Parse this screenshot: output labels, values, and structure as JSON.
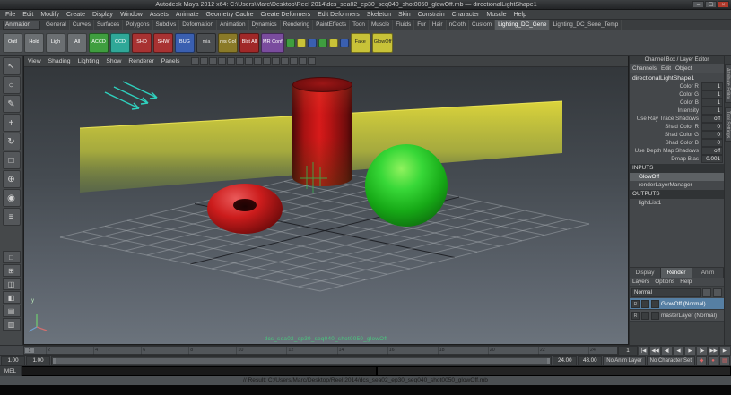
{
  "window": {
    "title": "Autodesk Maya 2012 x64: C:\\Users\\Marc\\Desktop\\Reel 2014\\dcs_sea02_ep30_seq040_shot0050_glowOff.mb  —  directionalLightShape1",
    "minimize": "–",
    "maximize": "☐",
    "close": "×"
  },
  "menubar": {
    "items": [
      "File",
      "Edit",
      "Modify",
      "Create",
      "Display",
      "Window",
      "Assets",
      "Animate",
      "Geometry Cache",
      "Create Deformers",
      "Edit Deformers",
      "Skeleton",
      "Skin",
      "Constrain",
      "Character",
      "Muscle",
      "Help"
    ]
  },
  "shelf_tabs": {
    "menu_set": "Animation",
    "tabs": [
      {
        "label": "General"
      },
      {
        "label": "Curves"
      },
      {
        "label": "Surfaces"
      },
      {
        "label": "Polygons"
      },
      {
        "label": "Subdivs"
      },
      {
        "label": "Deformation"
      },
      {
        "label": "Animation"
      },
      {
        "label": "Dynamics"
      },
      {
        "label": "Rendering"
      },
      {
        "label": "PaintEffects"
      },
      {
        "label": "Toon"
      },
      {
        "label": "Muscle"
      },
      {
        "label": "Fluids"
      },
      {
        "label": "Fur"
      },
      {
        "label": "Hair"
      },
      {
        "label": "nCloth"
      },
      {
        "label": "Custom"
      },
      {
        "label": "Lighting_DC_Gene",
        "active": true
      },
      {
        "label": "Lighting_DC_Sene_Temp"
      }
    ]
  },
  "shelf": {
    "items": [
      {
        "label": "Outl",
        "bg": "#6b6f72"
      },
      {
        "label": "Hold",
        "bg": "#6b6f72"
      },
      {
        "label": "Ligh",
        "bg": "#6b6f72"
      },
      {
        "label": "All",
        "bg": "#6b6f72"
      },
      {
        "label": "ACCD",
        "bg": "#3f9e3f"
      },
      {
        "label": "CCD",
        "bg": "#2fa898"
      },
      {
        "label": "SHD",
        "bg": "#a83232"
      },
      {
        "label": "SHW",
        "bg": "#a83232"
      },
      {
        "label": "BUG",
        "bg": "#3a5fb0"
      },
      {
        "label": "mia",
        "bg": "#4a4d50",
        "fg": "#dddddd"
      },
      {
        "label": "res Gol",
        "bg": "#8a7a28"
      },
      {
        "label": "Blst All",
        "bg": "#a02828"
      },
      {
        "label": "MR Conf",
        "bg": "#7a4c9e"
      },
      {
        "label": "",
        "bg": "#3f9e3f",
        "small": true
      },
      {
        "label": "",
        "bg": "#c8c238",
        "small": true
      },
      {
        "label": "",
        "bg": "#3a5fb0",
        "small": true
      },
      {
        "label": "",
        "bg": "#3f9e3f",
        "small": true
      },
      {
        "label": "",
        "bg": "#c8c238",
        "small": true
      },
      {
        "label": "",
        "bg": "#3a5fb0",
        "small": true
      },
      {
        "label": "Fake",
        "bg": "#c8c238",
        "fg": "#222222"
      },
      {
        "label": "GlowOff",
        "bg": "#c8c238",
        "fg": "#222222"
      }
    ]
  },
  "toolbox": {
    "tools": [
      {
        "name": "select-tool",
        "glyph": "↖"
      },
      {
        "name": "lasso-tool",
        "glyph": "○"
      },
      {
        "name": "paint-select-tool",
        "glyph": "✎"
      },
      {
        "name": "move-tool",
        "glyph": "+"
      },
      {
        "name": "rotate-tool",
        "glyph": "↻"
      },
      {
        "name": "scale-tool",
        "glyph": "□"
      },
      {
        "name": "universal-manipulator-tool",
        "glyph": "⊕"
      },
      {
        "name": "soft-mod-tool",
        "glyph": "◉"
      },
      {
        "name": "last-tool",
        "glyph": "≡"
      }
    ],
    "layouts": [
      {
        "name": "single-pane-layout-button",
        "glyph": "□"
      },
      {
        "name": "four-pane-layout-button",
        "glyph": "⊞"
      },
      {
        "name": "two-pane-layout-button",
        "glyph": "◫"
      },
      {
        "name": "persp-outliner-layout-button",
        "glyph": "◧"
      },
      {
        "name": "hypershade-layout-button",
        "glyph": "▤"
      },
      {
        "name": "graph-layout-button",
        "glyph": "▥"
      }
    ]
  },
  "panel_menu": {
    "items": [
      "View",
      "Shading",
      "Lighting",
      "Show",
      "Renderer",
      "Panels"
    ],
    "icons": [
      "select-camera-icon",
      "lock-camera-icon",
      "camera-attributes-icon",
      "bookmark-icon",
      "image-plane-icon",
      "two-d-pan-zoom-icon",
      "grid-icon",
      "film-gate-icon",
      "resolution-gate-icon",
      "gate-mask-icon",
      "field-chart-icon",
      "safe-action-icon",
      "safe-title-icon",
      "hud-icon"
    ]
  },
  "viewport": {
    "hud": "dcs_sea02_ep30_seq040_shot0050_glowOff",
    "axis_label": "y",
    "background_top": "#33373b",
    "background_bottom": "#6b737c"
  },
  "scene": {
    "objects": [
      {
        "name": "red-cylinder",
        "color": "#c81414"
      },
      {
        "name": "red-torus",
        "color": "#b01212"
      },
      {
        "name": "green-sphere",
        "color": "#28c828"
      },
      {
        "name": "yellow-light-plane",
        "color": "#e2da3c"
      },
      {
        "name": "directional-light-arrows",
        "color": "#2fd0bd"
      }
    ]
  },
  "channel_box": {
    "header": "Channel Box / Layer Editor",
    "menus": [
      "Channels",
      "Edit",
      "Object"
    ],
    "node": "directionalLightShape1",
    "channels": [
      {
        "name": "Color R",
        "value": "1"
      },
      {
        "name": "Color G",
        "value": "1"
      },
      {
        "name": "Color B",
        "value": "1"
      },
      {
        "name": "Intensity",
        "value": "1"
      },
      {
        "name": "Use Ray Trace Shadows",
        "value": "off"
      },
      {
        "name": "Shad Color R",
        "value": "0"
      },
      {
        "name": "Shad Color G",
        "value": "0"
      },
      {
        "name": "Shad Color B",
        "value": "0"
      },
      {
        "name": "Use Depth Map Shadows",
        "value": "off"
      },
      {
        "name": "Dmap Bias",
        "value": "0.001"
      }
    ],
    "inputs_label": "INPUTS",
    "inputs": [
      {
        "name": "GlowOff",
        "selected": true
      },
      {
        "name": "renderLayerManager"
      }
    ],
    "outputs_label": "OUTPUTS",
    "outputs": [
      {
        "name": "lightList1"
      }
    ]
  },
  "layer_editor": {
    "tabs": [
      {
        "label": "Display"
      },
      {
        "label": "Render",
        "active": true
      },
      {
        "label": "Anim"
      }
    ],
    "menus": [
      "Layers",
      "Options",
      "Help"
    ],
    "blend_mode": "Normal",
    "layers": [
      {
        "name": "GlowOff (Normal)",
        "selected": true
      },
      {
        "name": "masterLayer (Normal)"
      }
    ]
  },
  "sidebar_tabs": [
    "Attribute Editor",
    "Tool Settings"
  ],
  "time_slider": {
    "ticks": [
      "2",
      "4",
      "6",
      "8",
      "10",
      "12",
      "14",
      "16",
      "18",
      "20",
      "22",
      "24"
    ],
    "current_frame": "1"
  },
  "playback": {
    "buttons": [
      {
        "name": "go-to-start-button",
        "glyph": "|◀"
      },
      {
        "name": "step-back-key-button",
        "glyph": "◀◀"
      },
      {
        "name": "step-back-frame-button",
        "glyph": "◀|"
      },
      {
        "name": "play-backward-button",
        "glyph": "◀"
      },
      {
        "name": "play-forward-button",
        "glyph": "▶"
      },
      {
        "name": "step-forward-frame-button",
        "glyph": "|▶"
      },
      {
        "name": "step-forward-key-button",
        "glyph": "▶▶"
      },
      {
        "name": "go-to-end-button",
        "glyph": "▶|"
      }
    ]
  },
  "range_slider": {
    "anim_start": "1.00",
    "playback_start": "1.00",
    "playback_end": "24.00",
    "anim_end": "48.00",
    "anim_layer": "No Anim Layer",
    "character_set": "No Character Set",
    "keys": [
      {
        "name": "set-key-button",
        "glyph": "◆"
      },
      {
        "name": "auto-key-button",
        "glyph": "●"
      },
      {
        "name": "animation-preferences-button",
        "glyph": "▤"
      }
    ]
  },
  "command_line": {
    "label": "MEL"
  },
  "help_line": {
    "text": "// Result: C:/Users/Marc/Desktop/Reel 2014/dcs_sea02_ep30_seq040_shot0050_glowOff.mb"
  }
}
